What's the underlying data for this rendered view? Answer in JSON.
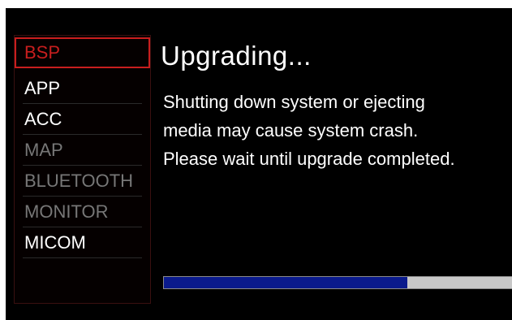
{
  "sidebar": {
    "items": [
      {
        "label": "BSP",
        "state": "selected"
      },
      {
        "label": "APP",
        "state": "active"
      },
      {
        "label": "ACC",
        "state": "active"
      },
      {
        "label": "MAP",
        "state": "disabled"
      },
      {
        "label": "BLUETOOTH",
        "state": "disabled"
      },
      {
        "label": "MONITOR",
        "state": "disabled"
      },
      {
        "label": "MICOM",
        "state": "active"
      }
    ]
  },
  "main": {
    "title": "Upgrading...",
    "message_lines": [
      "Shutting down system or ejecting",
      "media may cause system crash.",
      "Please wait until upgrade completed."
    ]
  },
  "progress": {
    "fraction": 0.7
  },
  "colors": {
    "background": "#000000",
    "selected": "#c81e1e",
    "active_text": "#ffffff",
    "disabled_text": "#777777",
    "progress_fill": "#0a1a8c",
    "progress_track": "#c8c8c8"
  }
}
